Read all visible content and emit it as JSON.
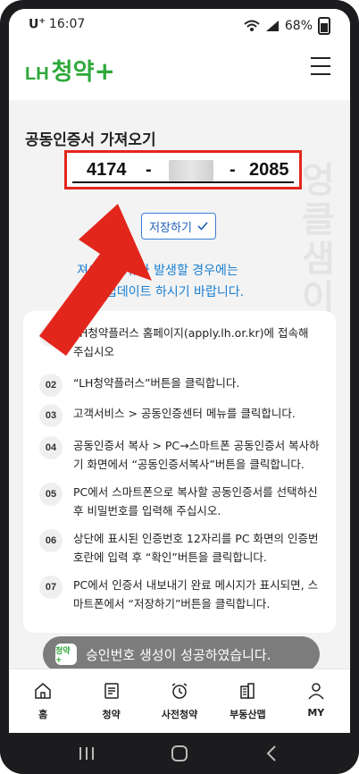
{
  "status_bar": {
    "carrier": "U",
    "carrier_sup": "+",
    "time": "16:07",
    "battery": "68%"
  },
  "app": {
    "logo_lh": "LH",
    "logo_main": "청약",
    "logo_plus": "+"
  },
  "page": {
    "title": "공동인증서 가져오기",
    "code": {
      "part1": "4174",
      "separator1": "-",
      "separator2": "-",
      "part3": "2085"
    },
    "save_button": "저장하기",
    "notice_line1": "져오기 오류가 발생할 경우에는",
    "notice_line2": "업데이트 하시기 바랍니다."
  },
  "steps": [
    {
      "num": "01",
      "text": "LH청약플러스 홈페이지(apply.lh.or.kr)에 접속해 주십시오"
    },
    {
      "num": "02",
      "text": "“LH청약플러스”버튼을 클릭합니다."
    },
    {
      "num": "03",
      "text": "고객서비스 > 공동인증센터 메뉴를 클릭합니다."
    },
    {
      "num": "04",
      "text": "공동인증서 복사 > PC→스마트폰 공동인증서 복사하기 화면에서 “공동인증서복사”버튼을 클릭합니다."
    },
    {
      "num": "05",
      "text": "PC에서 스마트폰으로 복사할 공동인증서를 선택하신 후 비밀번호를 입력해 주십시오."
    },
    {
      "num": "06",
      "text": "상단에 표시된 인증번호 12자리를 PC 화면의 인증번호란에 입력 후 “확인”버튼을 클릭합니다."
    },
    {
      "num": "07",
      "text": "PC에서 인증서 내보내기 완료 메시지가 표시되면, 스마트폰에서 “저장하기”버튼을 클릭합니다."
    }
  ],
  "watermark": "엉클샘이체지극묘실",
  "toast": {
    "icon_text": "청약+",
    "message": "승인번호 생성이 성공하였습니다."
  },
  "bottom_nav": [
    {
      "label": "홈",
      "icon": "home-icon"
    },
    {
      "label": "청약",
      "icon": "document-icon"
    },
    {
      "label": "사전청약",
      "icon": "alarm-icon"
    },
    {
      "label": "부동산맵",
      "icon": "building-icon"
    },
    {
      "label": "MY",
      "icon": "user-icon"
    }
  ],
  "colors": {
    "brand_green": "#2ea83a",
    "highlight_red": "#e3261c",
    "link_blue": "#1a7fd2"
  }
}
